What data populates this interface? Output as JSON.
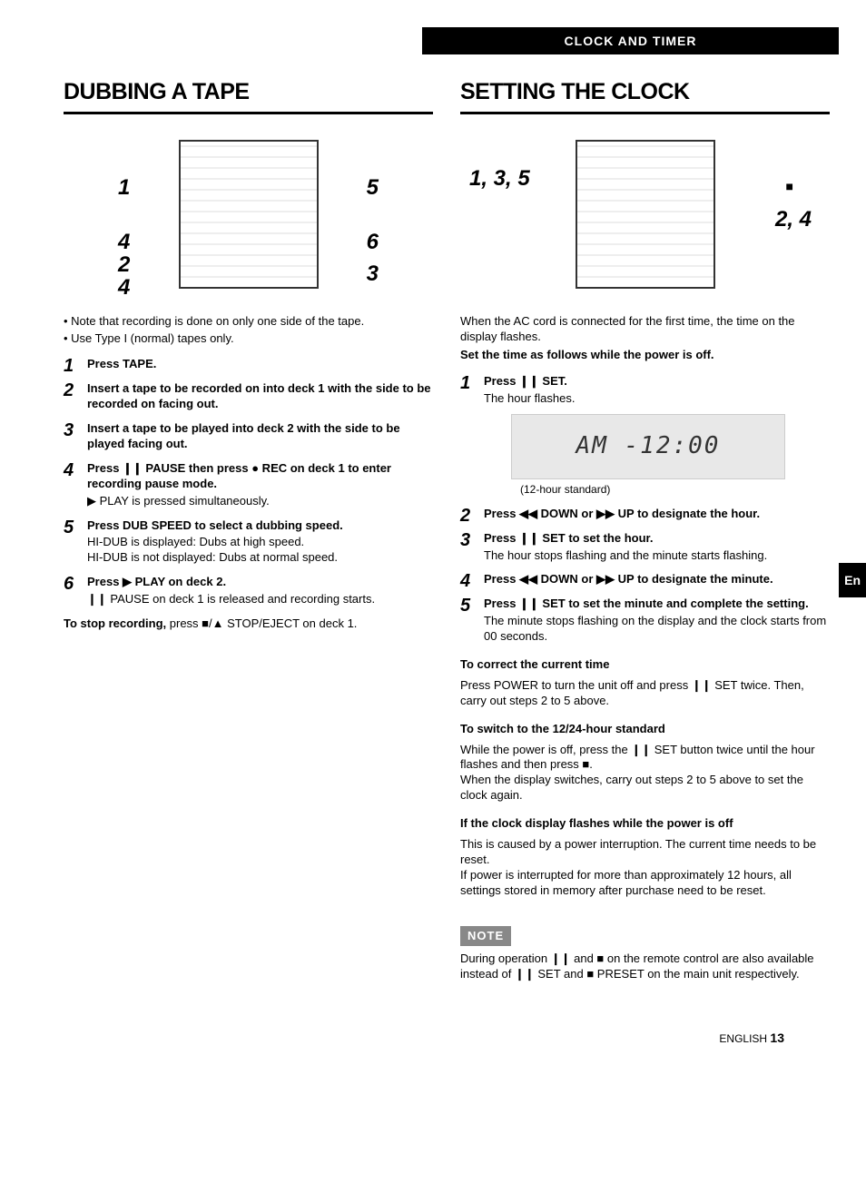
{
  "topbar": "CLOCK AND TIMER",
  "left": {
    "heading": "DUBBING A TAPE",
    "diagram_labels": {
      "l1": "1",
      "l2": "4",
      "l3": "2",
      "l4": "4",
      "r1": "5",
      "r2": "6",
      "r3": "3"
    },
    "note1": "• Note that recording is done on only one side of the tape.",
    "note2": "• Use Type I (normal) tapes only.",
    "steps": [
      {
        "n": "1",
        "title": "Press TAPE."
      },
      {
        "n": "2",
        "title": "Insert a tape to be recorded on into deck 1 with the side to be recorded on facing out."
      },
      {
        "n": "3",
        "title": "Insert a tape to be played into deck 2 with the side to be played facing out."
      },
      {
        "n": "4",
        "title": "Press ❙❙ PAUSE then press ● REC on deck 1 to enter recording pause mode.",
        "sub": "▶ PLAY is pressed simultaneously."
      },
      {
        "n": "5",
        "title": "Press DUB SPEED to select a dubbing speed.",
        "sub": "HI-DUB is displayed: Dubs at high speed.\nHI-DUB is not displayed: Dubs at normal speed."
      },
      {
        "n": "6",
        "title": "Press ▶ PLAY on deck 2.",
        "sub": "❙❙ PAUSE on deck 1 is released and recording starts."
      }
    ],
    "stop_title": "To stop recording,",
    "stop_text": " press ■/▲ STOP/EJECT on deck 1."
  },
  "right": {
    "heading": "SETTING THE CLOCK",
    "diagram_labels": {
      "left": "1, 3, 5",
      "r1": "■",
      "r2": "2, 4"
    },
    "intro1": "When the AC cord is connected for the first time, the time on the display flashes.",
    "intro2": "Set the time as follows while the power is off.",
    "display_text": "AM -12:00",
    "display_caption": "(12-hour standard)",
    "steps": [
      {
        "n": "1",
        "title": "Press ❙❙ SET.",
        "sub": "The hour flashes."
      },
      {
        "n": "2",
        "title": "Press ◀◀ DOWN or ▶▶ UP to designate the hour."
      },
      {
        "n": "3",
        "title": "Press ❙❙ SET to set the hour.",
        "sub": "The hour stops flashing and the minute starts flashing."
      },
      {
        "n": "4",
        "title": "Press ◀◀ DOWN or ▶▶ UP to designate the minute."
      },
      {
        "n": "5",
        "title": "Press ❙❙ SET to set the minute and complete the setting.",
        "sub": "The minute stops flashing on the display and the clock starts from 00 seconds."
      }
    ],
    "correct_h": "To correct the current time",
    "correct_t": "Press POWER to turn the unit off and press ❙❙ SET twice. Then, carry out steps 2 to 5 above.",
    "switch_h": "To switch to the 12/24-hour standard",
    "switch_t": "While the power is off, press the ❙❙ SET button twice until the hour flashes and then press ■.\nWhen the display switches, carry out steps 2 to 5 above to set the clock again.",
    "flash_h": "If the clock display flashes while the power is off",
    "flash_t": "This is caused by a power interruption. The current time needs to be reset.\nIf power is interrupted for more than approximately 12 hours, all settings stored in memory after purchase need to be reset.",
    "note_label": "NOTE",
    "note_text": "During operation ❙❙ and ■ on the remote control are also available instead of ❙❙ SET and ■ PRESET on the main unit respectively."
  },
  "entab": "En",
  "footer_lang": "ENGLISH ",
  "footer_page": "13"
}
